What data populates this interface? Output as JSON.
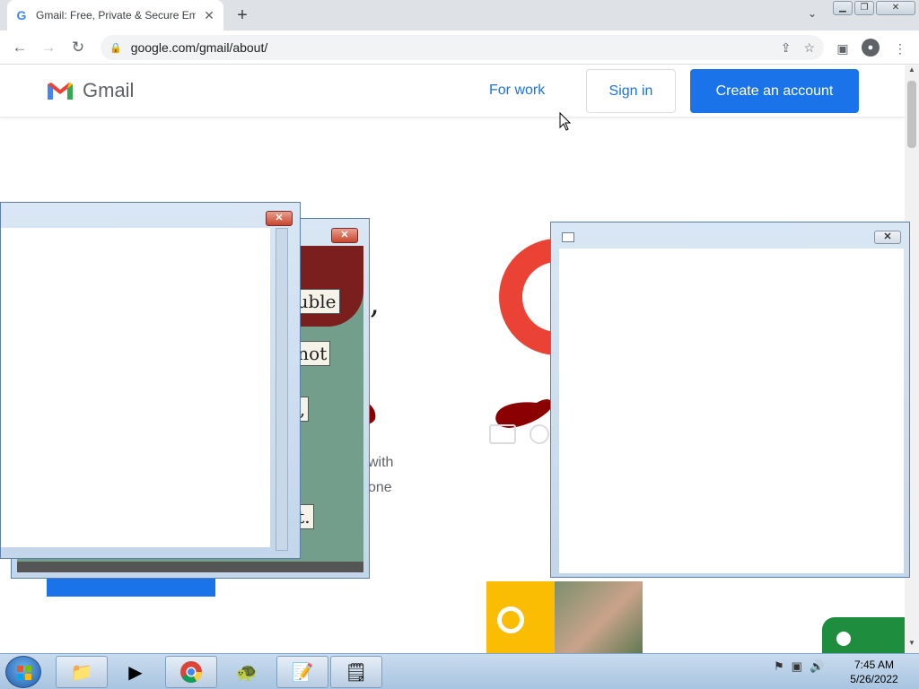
{
  "browser": {
    "tab_title": "Gmail: Free, Private & Secure Em",
    "tab_favicon": "G",
    "url": "google.com/gmail/about/"
  },
  "header": {
    "brand": "Gmail",
    "for_work": "For work",
    "sign_in": "Sign in",
    "create_account": "Create an account"
  },
  "page_fragments": {
    "fragment_1": "with",
    "fragment_2": "one"
  },
  "notes": {
    "n1": "rouble",
    "n2": "a not",
    "n3": "dt,",
    "n4": "e t."
  },
  "taskbar": {
    "time": "7:45 AM",
    "date": "5/26/2022"
  },
  "colors": {
    "accent": "#1a73e8",
    "gmail_red": "#ea4335"
  }
}
